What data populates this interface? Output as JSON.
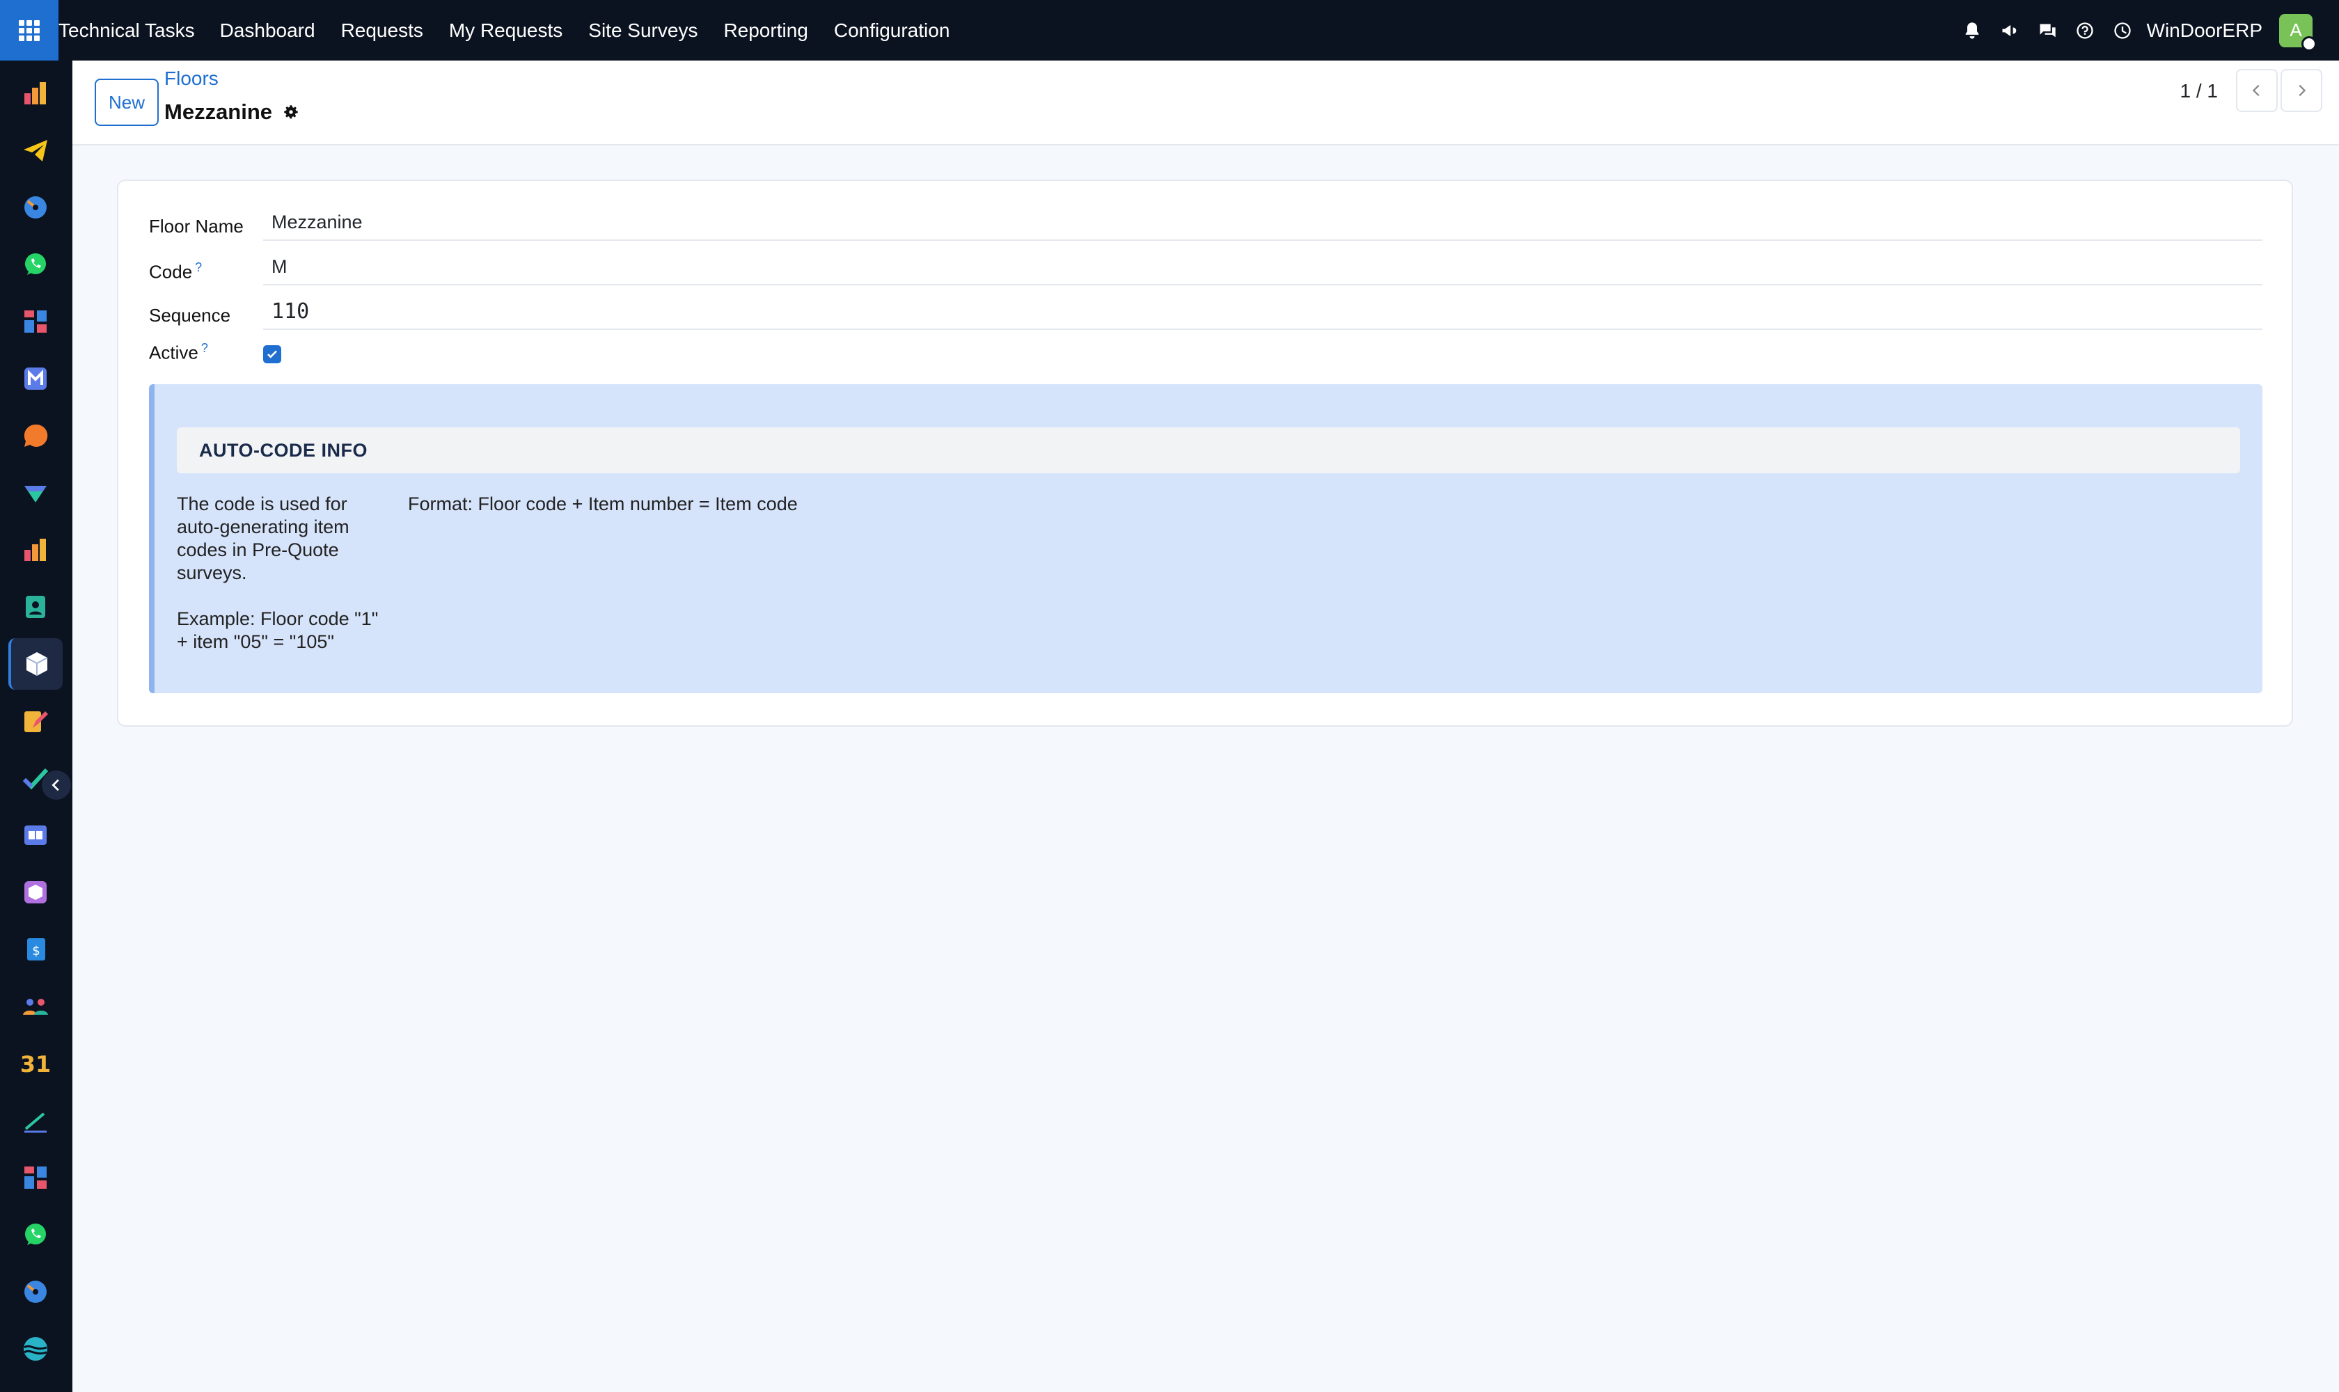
{
  "topbar": {
    "app_title": "Technical Tasks",
    "menu": [
      "Dashboard",
      "Requests",
      "My Requests",
      "Site Surveys",
      "Reporting",
      "Configuration"
    ],
    "icons": [
      "bell-icon",
      "megaphone-icon",
      "chat-icon",
      "help-icon",
      "clock-icon"
    ],
    "company": "WinDoorERP",
    "avatar_initial": "A"
  },
  "sidebar": {
    "items": [
      {
        "icon": "sales-chart-icon",
        "color": "#f29a3a"
      },
      {
        "icon": "paper-plane-icon",
        "color": "#f5c518"
      },
      {
        "icon": "gauge-icon",
        "color": "#3a86e0"
      },
      {
        "icon": "whatsapp-icon",
        "color": "#25d366"
      },
      {
        "icon": "dashboard-icon",
        "color": "#e8566b"
      },
      {
        "icon": "mail-icon",
        "color": "#5b7be8"
      },
      {
        "icon": "chat-bubble-icon",
        "color": "#f27a2b"
      },
      {
        "icon": "discount-icon",
        "color": "#2ac7a0"
      },
      {
        "icon": "bar-chart-icon",
        "color": "#f29a3a"
      },
      {
        "icon": "contact-card-icon",
        "color": "#2ab39a"
      },
      {
        "icon": "cube-icon",
        "color": "#ffffff"
      },
      {
        "icon": "pencil-paper-icon",
        "color": "#f2b33a"
      },
      {
        "icon": "checkmark-icon",
        "color": "#2ac7a0"
      },
      {
        "icon": "book-icon",
        "color": "#5b7be8"
      },
      {
        "icon": "box-icon",
        "color": "#b070e0"
      },
      {
        "icon": "invoice-icon",
        "color": "#2a8ae0"
      },
      {
        "icon": "people-icon",
        "color": "#f29a3a"
      },
      {
        "icon": "calendar-icon",
        "color": "#f2b33a",
        "label": "31"
      },
      {
        "icon": "sign-icon",
        "color": "#2ac7a0"
      },
      {
        "icon": "dashboard-icon",
        "color": "#5b7be8"
      },
      {
        "icon": "whatsapp-icon",
        "color": "#25d366"
      },
      {
        "icon": "gauge-icon",
        "color": "#3a86e0"
      },
      {
        "icon": "wave-icon",
        "color": "#2ab3c7"
      }
    ]
  },
  "control": {
    "new_label": "New",
    "breadcrumb": "Floors",
    "record_title": "Mezzanine",
    "pager": "1 / 1"
  },
  "form": {
    "fields": {
      "floor_name": {
        "label": "Floor Name",
        "value": "Mezzanine"
      },
      "code": {
        "label": "Code",
        "help": "?",
        "value": "M"
      },
      "sequence": {
        "label": "Sequence",
        "value": "110"
      },
      "active": {
        "label": "Active",
        "help": "?",
        "checked": true
      }
    },
    "info": {
      "title": "AUTO-CODE INFO",
      "left_p1": "The code is used for auto-generating item codes in Pre-Quote surveys.",
      "left_p2": "Example: Floor code \"1\" + item \"05\" = \"105\"",
      "right": "Format: Floor code + Item number = Item code"
    }
  }
}
